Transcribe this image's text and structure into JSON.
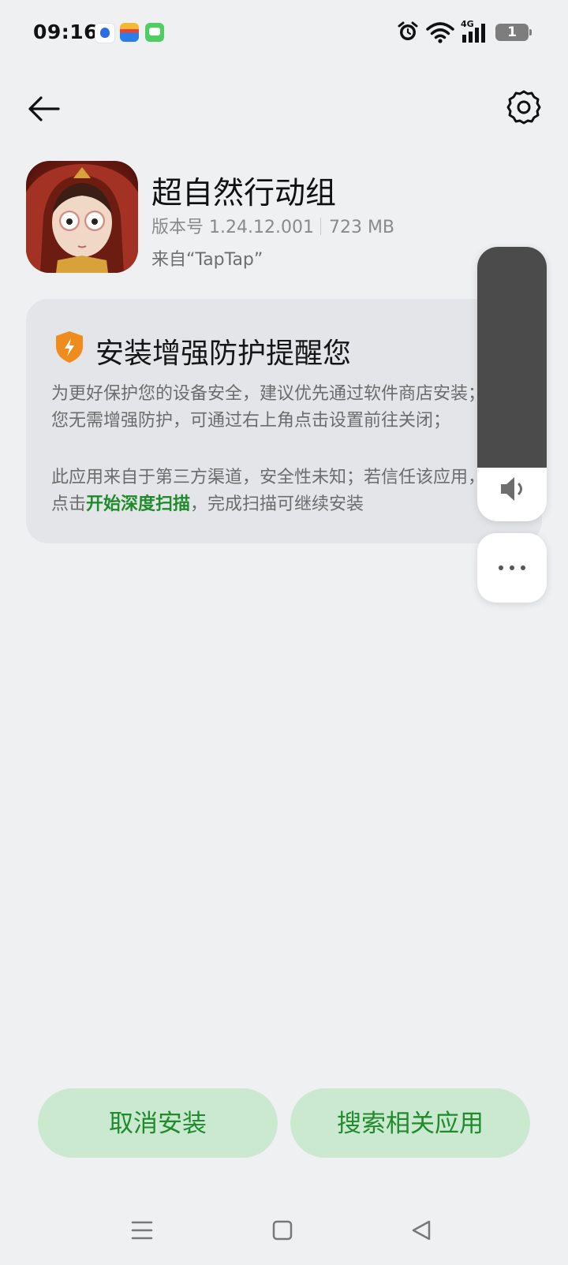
{
  "status_bar": {
    "time": "09:16",
    "network": "4G",
    "battery_level": "1",
    "notification_icons": [
      "baidu-icon",
      "wallet-icon",
      "messages-icon"
    ],
    "indicator_icons": [
      "alarm-icon",
      "wifi-icon",
      "signal-icon",
      "battery-icon"
    ]
  },
  "header": {
    "back_icon": "arrow-left-icon",
    "settings_icon": "gear-icon"
  },
  "app": {
    "name": "超自然行动组",
    "version": "版本号 1.24.12.001",
    "size": "723 MB",
    "source": "来自“TapTap”"
  },
  "warning_card": {
    "title": "安装增强防护提醒您",
    "paragraph1": "为更好保护您的设备安全，建议优先通过软件商店安装；若您无需增强防护，可通过右上角点击设置前往关闭；",
    "paragraph2_before": "此应用来自于第三方渠道，安全性未知；若信任该应用，可点击",
    "paragraph2_link": "开始深度扫描",
    "paragraph2_after": "，完成扫描可继续安装"
  },
  "volume_panel": {
    "icon": "speaker-icon",
    "more_icon": "more-dots-icon",
    "level": 0.0
  },
  "buttons": {
    "cancel": "取消安装",
    "search": "搜索相关应用"
  },
  "nav": {
    "items": [
      "menu-icon",
      "home-icon",
      "back-triangle-icon"
    ]
  },
  "colors": {
    "accent": "#1e8c2a",
    "button_bg": "#cbe8d0",
    "shield": "#f08c1e",
    "background": "#eff0f2"
  }
}
